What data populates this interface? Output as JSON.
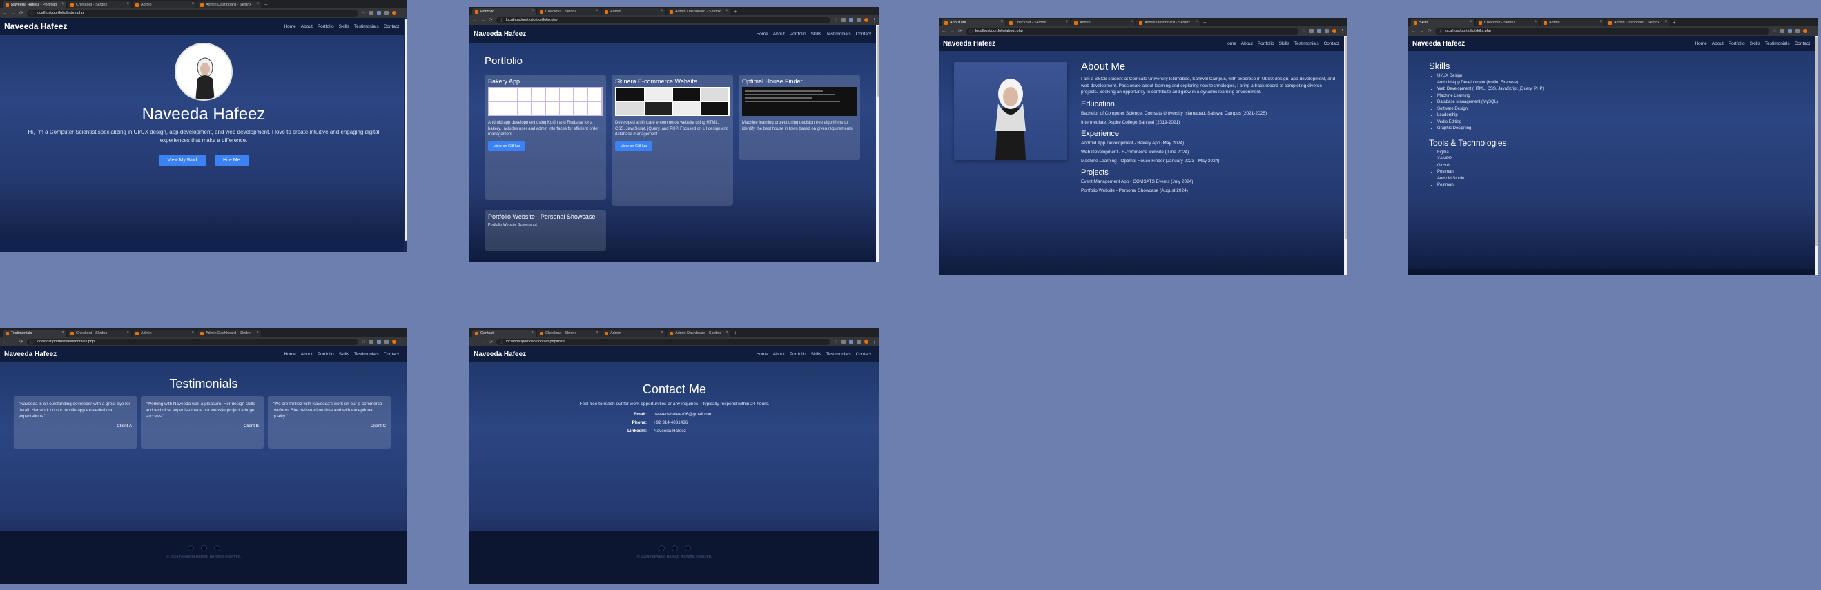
{
  "site": {
    "brand": "Naveeda Hafeez",
    "nav": [
      "Home",
      "About",
      "Portfolio",
      "Skills",
      "Testimonials",
      "Contact"
    ],
    "copyright": "© 2024 Naveeda Hafeez. All rights reserved."
  },
  "windows": [
    {
      "tabs": [
        "Naveeda Hafeez - Portfolio",
        "Checkout - Skrdnx",
        "Admin",
        "Admin Dashboard - Skrdnx"
      ],
      "url": "localhost/portfolio/index.php"
    },
    {
      "tabs": [
        "Portfolio",
        "Checkout - Skrdnx",
        "Admin",
        "Admin Dashboard - Skrdnx"
      ],
      "url": "localhost/portfolio/portfolio.php"
    },
    {
      "tabs": [
        "About Me",
        "Checkout - Skrdnx",
        "Admin",
        "Admin Dashboard - Skrdnx"
      ],
      "url": "localhost/portfolio/about.php"
    },
    {
      "tabs": [
        "Skills",
        "Checkout - Skrdnx",
        "Admin",
        "Admin Dashboard - Skrdnx"
      ],
      "url": "localhost/portfolio/skills.php"
    },
    {
      "tabs": [
        "Testimonials",
        "Checkout - Skrdnx",
        "Admin",
        "Admin Dashboard - Skrdnx"
      ],
      "url": "localhost/portfolio/testimonials.php"
    },
    {
      "tabs": [
        "Contact",
        "Checkout - Skrdnx",
        "Admin",
        "Admin Dashboard - Skrdnx"
      ],
      "url": "localhost/portfolio/contact.php#hire"
    }
  ],
  "home": {
    "name": "Naveeda Hafeez",
    "intro": "Hi, I'm a Computer Scientist specializing in UI/UX design, app development, and web development. I love to create intuitive and engaging digital experiences that make a difference.",
    "btn_work": "View My Work",
    "btn_hire": "Hire Me"
  },
  "portfolio": {
    "title": "Portfolio",
    "github": "View on GitHub",
    "projects": [
      {
        "title": "Bakery App",
        "desc": "Android app development using Kotlin and Firebase for a bakery. Includes user and admin interfaces for efficient order management."
      },
      {
        "title": "Skinera E-commerce Website",
        "desc": "Developed a skincare e-commerce website using HTML, CSS, JavaScript, jQuery, and PHP. Focused on UI design and database management."
      },
      {
        "title": "Optimal House Finder",
        "desc": "Machine learning project using decision tree algorithms to identify the best house in town based on given requirements."
      },
      {
        "title": "Portfolio Website - Personal Showcase",
        "desc": "Portfolio Website Screenshot"
      }
    ]
  },
  "about": {
    "title": "About Me",
    "bio": "I am a BSCS student at Comsats University Islamabad, Sahiwal Campus, with expertise in UI/UX design, app development, and web development. Passionate about learning and exploring new technologies, I bring a track record of completing diverse projects. Seeking an opportunity to contribute and grow in a dynamic learning environment.",
    "edu_title": "Education",
    "education": [
      "Bachelor of Computer Science, Comsats University Islamabad, Sahiwal Campus (2021-2025)",
      "Intermediate, Aspire College Sahiwal (2019-2021)"
    ],
    "exp_title": "Experience",
    "experience": [
      "Android App Development - Bakery App (May 2024)",
      "Web Development - E-commerce website (June 2024)",
      "Machine Learning - Optimal House Finder (January 2023 - May 2024)"
    ],
    "proj_title": "Projects",
    "projects": [
      "Event Management App - COMSATS Events (July 2024)",
      "Portfolio Website - Personal Showcase (August 2024)"
    ]
  },
  "skills": {
    "title": "Skills",
    "items": [
      "UI/UX Design",
      "Android App Development (Kotlin, Firebase)",
      "Web Development (HTML, CSS, JavaScript, jQuery, PHP)",
      "Machine Learning",
      "Database Management (MySQL)",
      "Software Design",
      "Leadership",
      "Vedio Editing",
      "Graphic Designing"
    ],
    "tools_title": "Tools & Technologies",
    "tools": [
      "Figma",
      "XAMPP",
      "GitHub",
      "Postman",
      "Android Studio",
      "Postman"
    ]
  },
  "testimonials": {
    "title": "Testimonials",
    "items": [
      {
        "quote": "\"Naveeda is an outstanding developer with a great eye for detail. Her work on our mobile app exceeded our expectations.\"",
        "author": "- Client A"
      },
      {
        "quote": "\"Working with Naveeda was a pleasure. Her design skills and technical expertise made our website project a huge success.\"",
        "author": "- Client B"
      },
      {
        "quote": "\"We are thrilled with Naveeda's work on our e-commerce platform. She delivered on time and with exceptional quality.\"",
        "author": "- Client C"
      }
    ]
  },
  "contact": {
    "title": "Contact Me",
    "intro": "Feel free to reach out for work opportunities or any inquiries. I typically respond within 24 hours.",
    "email_label": "Email:",
    "email": "naveedahafeez06@gmail.com",
    "phone_label": "Phone:",
    "phone": "+92 314 4031436",
    "linkedin_label": "LinkedIn:",
    "linkedin": "Naveeda Hafeez"
  }
}
